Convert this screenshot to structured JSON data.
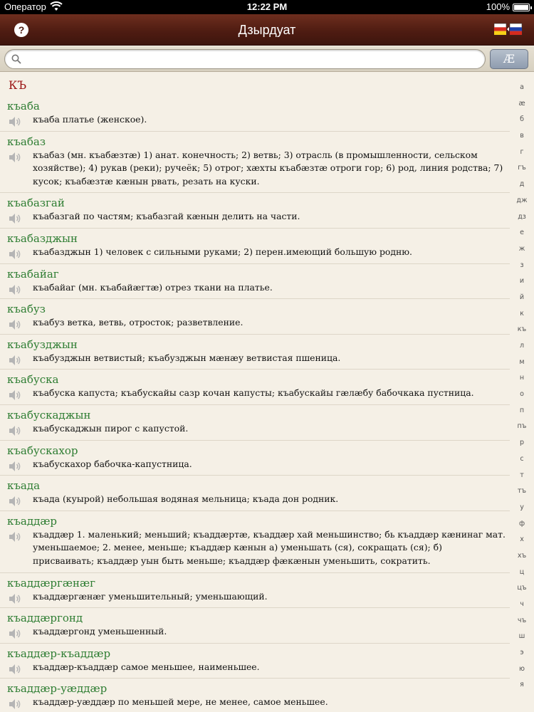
{
  "status_bar": {
    "carrier": "Оператор",
    "time": "12:22 PM",
    "battery_percent": "100%",
    "battery_level": 1.0
  },
  "nav": {
    "title": "Дзырдуат",
    "help_label": "?",
    "flags_icon": "ossetia-russia-flags-icon"
  },
  "search": {
    "value": "",
    "placeholder": "",
    "ae_button": "Æ"
  },
  "section_header": "КЪ",
  "entries": [
    {
      "word": "къаба",
      "definition": "къаба платье (женское)."
    },
    {
      "word": "къабаз",
      "definition": "къабаз (мн. къабæзтæ) 1) анат. конечность; 2) ветвь; 3) отрасль (в промышленности, сельском хозяйстве); 4) рукав (реки); ручеёк; 5) отрог; хæхты къабæзтæ отроги гор; 6) род, линия родства; 7) кусок; къабæзтæ кæнын рвать, резать на куски."
    },
    {
      "word": "къабазгай",
      "definition": "къабазгай по частям; къабазгай кæнын делить на части."
    },
    {
      "word": "къабазджын",
      "definition": "къабазджын 1) человек с сильными руками; 2) перен.имеющий большую родню."
    },
    {
      "word": "къабайаг",
      "definition": "къабайаг (мн. къабайæгтæ) отрез ткани на платье."
    },
    {
      "word": "къабуз",
      "definition": "къабуз ветка, ветвь, отросток; разветвление."
    },
    {
      "word": "къабузджын",
      "definition": "къабузджын ветвистый; къабузджын мæнæу ветвистая пшеница."
    },
    {
      "word": "къабуска",
      "definition": "къабуска капуста; къабускайы сазр кочан капусты; къабускайы гæлæбу бабочкака пустница."
    },
    {
      "word": "къабускаджын",
      "definition": "къабускаджын пирог с капустой."
    },
    {
      "word": "къабускахор",
      "definition": "къабускахор бабочка-капустница."
    },
    {
      "word": "къада",
      "definition": "къада (куырой) небольшая водяная мельница; къада дон родник."
    },
    {
      "word": "къаддæр",
      "definition": "къаддæр 1. маленький; меньший; къаддæртæ, къаддæр хай меньшинство; бь къаддæр кæнинаг мат. уменьшаемое; 2. менее, меньше; къаддæр кæнын а) уменьшать (ся), сокращать (ся); б) присваивать; къаддæр уын быть меньше; къаддæр фæкæнын уменьшить, сократить."
    },
    {
      "word": "къаддæргæнæг",
      "definition": "къаддæргæнæг уменьшительный; уменьшающий."
    },
    {
      "word": "къаддæргонд",
      "definition": "къаддæргонд уменьшенный."
    },
    {
      "word": "къаддæр-къаддæр",
      "definition": "къаддæр-къаддæр самое меньшее, наименьшее."
    },
    {
      "word": "къаддæр-уæддæр",
      "definition": "къаддæр-уæддæр по меньшей мере, не менее, самое меньшее."
    }
  ],
  "index_letters": [
    "а",
    "æ",
    "б",
    "в",
    "г",
    "гъ",
    "д",
    "дж",
    "дз",
    "е",
    "ж",
    "з",
    "и",
    "й",
    "к",
    "къ",
    "л",
    "м",
    "н",
    "о",
    "п",
    "пъ",
    "р",
    "с",
    "т",
    "тъ",
    "у",
    "ф",
    "х",
    "хъ",
    "ц",
    "цъ",
    "ч",
    "чъ",
    "ш",
    "э",
    "ю",
    "я"
  ],
  "colors": {
    "nav_bar": "#4f1c12",
    "headword": "#2e7d32",
    "section_header": "#9b1515",
    "background": "#f5f0e6"
  }
}
